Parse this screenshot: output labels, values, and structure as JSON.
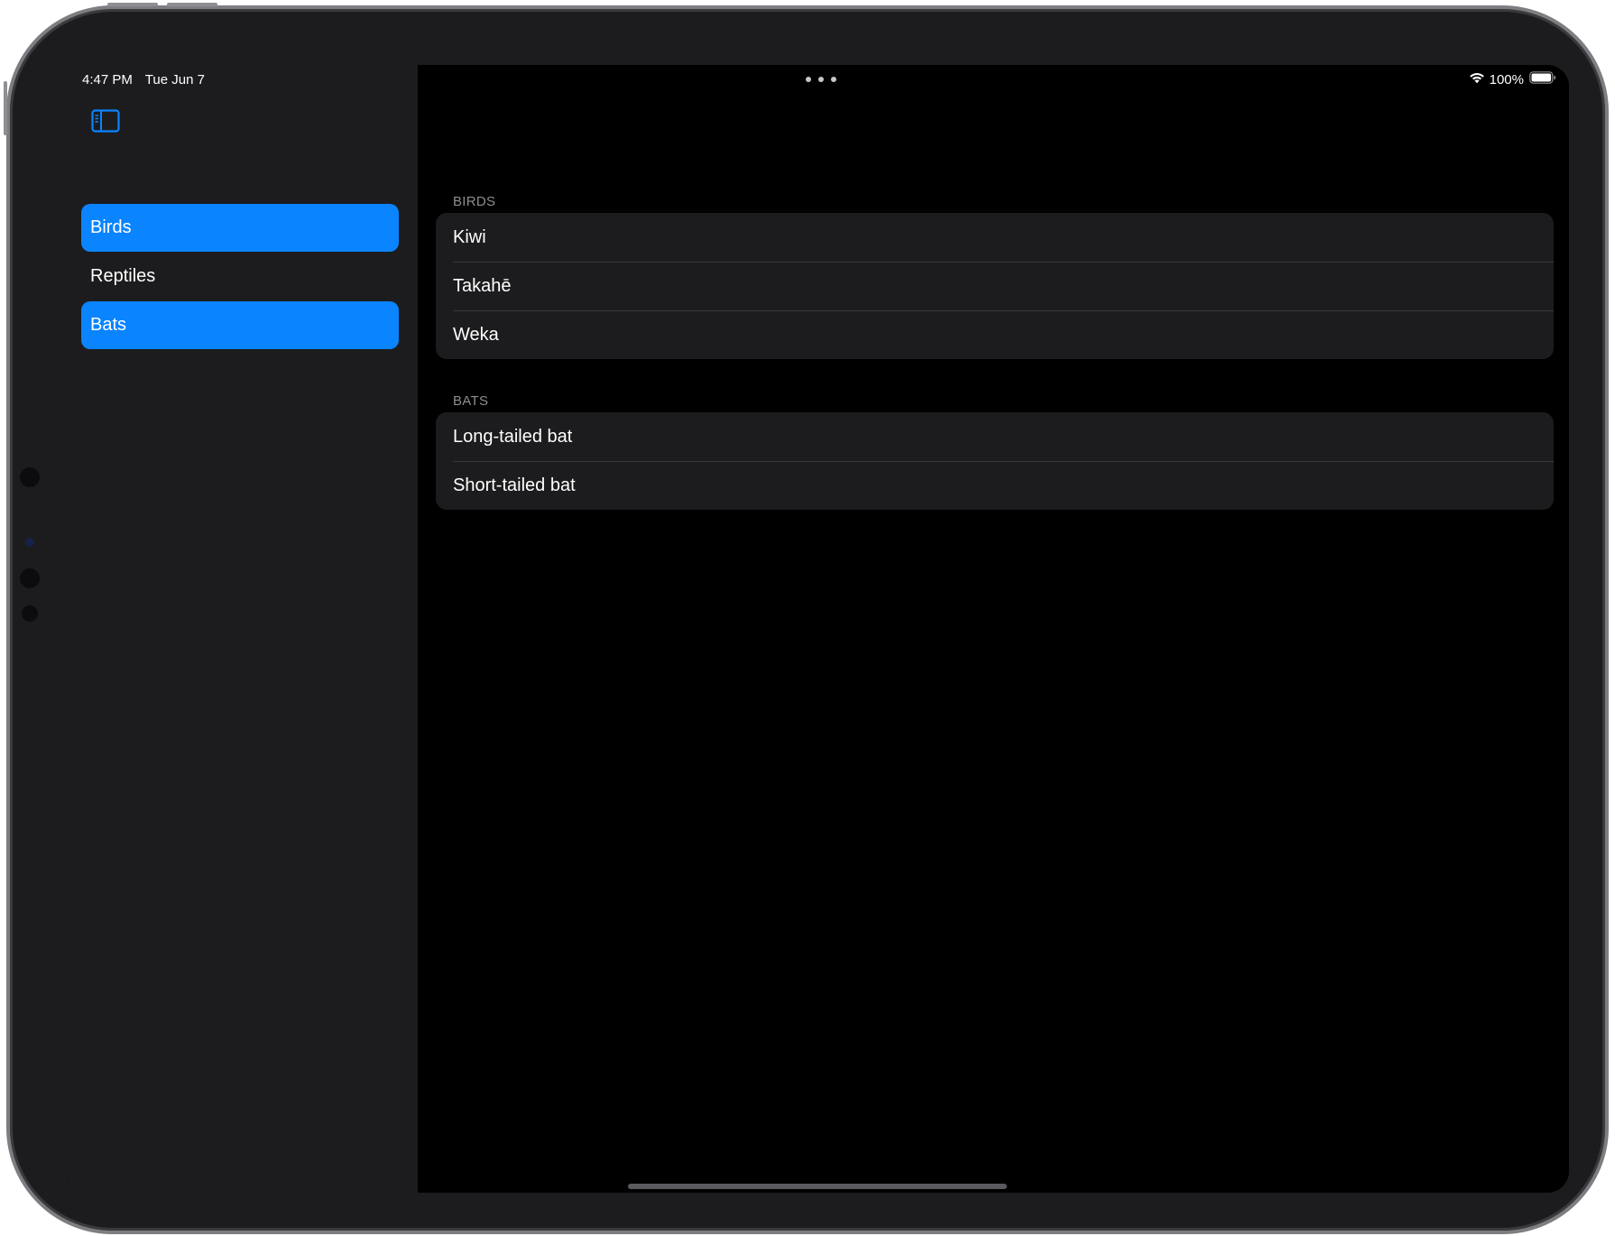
{
  "status_bar": {
    "time": "4:47 PM",
    "date": "Tue Jun 7",
    "battery": "100%",
    "wifi_icon": "wifi-icon",
    "battery_icon": "battery-icon"
  },
  "toolbar": {
    "sidebar_toggle_icon": "sidebar-toggle-icon",
    "multitasking_icon": "ellipsis-icon"
  },
  "sidebar": {
    "items": [
      {
        "label": "Birds",
        "selected": true
      },
      {
        "label": "Reptiles",
        "selected": false
      },
      {
        "label": "Bats",
        "selected": true
      }
    ]
  },
  "detail": {
    "sections": [
      {
        "header": "BIRDS",
        "rows": [
          "Kiwi",
          "Takahē",
          "Weka"
        ]
      },
      {
        "header": "BATS",
        "rows": [
          "Long-tailed bat",
          "Short-tailed bat"
        ]
      }
    ]
  },
  "colors": {
    "accent": "#0a84ff",
    "sidebar_background": "#1c1c1e",
    "detail_background": "#000000",
    "group_background": "#1c1c1e",
    "secondary_text": "#8e8e93"
  }
}
